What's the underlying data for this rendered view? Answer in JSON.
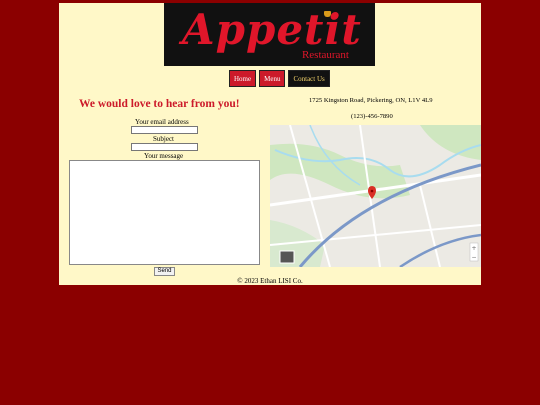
{
  "brand": {
    "script_text": "Appetit",
    "sub_text": "Restaurant"
  },
  "nav": [
    {
      "label": "Home"
    },
    {
      "label": "Menu"
    },
    {
      "label": "Contact Us"
    }
  ],
  "contact_form": {
    "heading": "We would love to hear from you!",
    "email_label": "Your email address",
    "subject_label": "Subject",
    "message_label": "Your message",
    "send_label": "Send"
  },
  "location": {
    "address": "1725 Kingston Road, Pickering, ON, L1V 4L9",
    "phone": "(123)-456-7890"
  },
  "map": {
    "water_color": "#a8dcef",
    "park_color": "#cfe7c0",
    "road_color": "#ffffff",
    "highway_color": "#7b98c8",
    "pin_color": "#d93025"
  },
  "footer": {
    "copyright": "© 2023 Ethan LISI Co."
  },
  "colors": {
    "background": "#8b0000",
    "page": "#fff8c8",
    "accent": "#cc1a2a"
  }
}
